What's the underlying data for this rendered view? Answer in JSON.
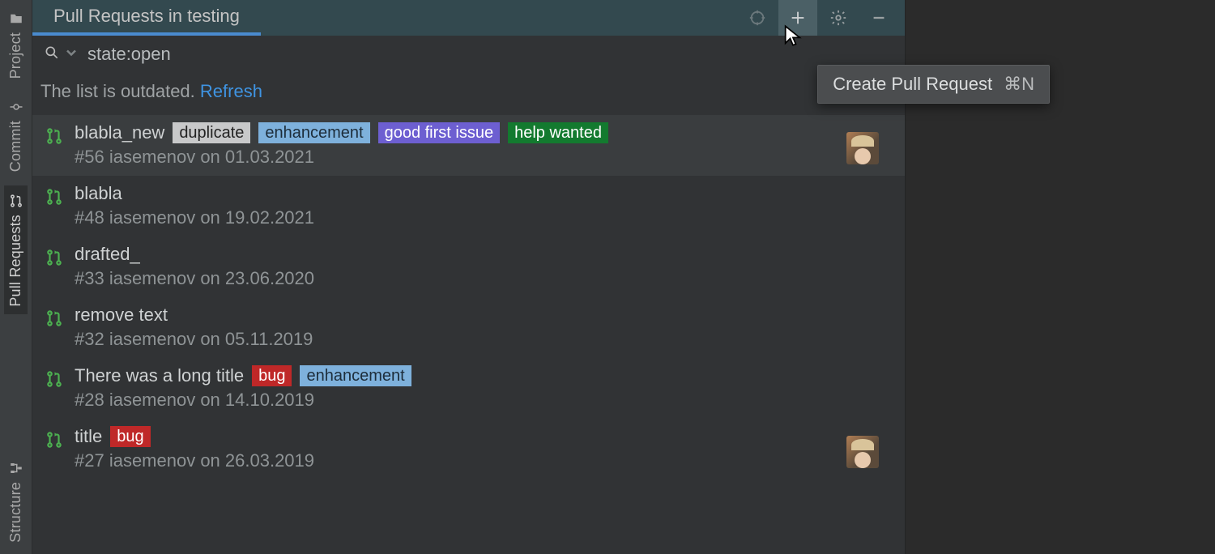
{
  "toolstrip": {
    "project": "Project",
    "commit": "Commit",
    "pull_requests": "Pull Requests",
    "structure": "Structure"
  },
  "header": {
    "tab_title": "Pull Requests in testing"
  },
  "search": {
    "value": "state:open"
  },
  "outdated": {
    "text": "The list is outdated.",
    "refresh": "Refresh"
  },
  "tooltip": {
    "text": "Create Pull Request",
    "shortcut": "⌘N"
  },
  "label_colors": {
    "duplicate": {
      "bg": "#c8c9ca",
      "fg": "#222"
    },
    "enhancement": {
      "bg": "#7eb1dc",
      "fg": "#1d2d3a"
    },
    "good_first_issue": {
      "bg": "#6d5fd1",
      "fg": "#fff"
    },
    "help_wanted": {
      "bg": "#137a2f",
      "fg": "#fff"
    },
    "bug": {
      "bg": "#bf2828",
      "fg": "#fff"
    }
  },
  "prs": [
    {
      "title": "blabla_new",
      "labels": [
        "duplicate",
        "enhancement",
        "good first issue",
        "help wanted"
      ],
      "sub": "#56 iasemenov on 01.03.2021",
      "selected": true,
      "avatar": true
    },
    {
      "title": "blabla",
      "labels": [],
      "sub": "#48 iasemenov on 19.02.2021",
      "selected": false,
      "avatar": false
    },
    {
      "title": "drafted_",
      "labels": [],
      "sub": "#33 iasemenov on 23.06.2020",
      "selected": false,
      "avatar": false
    },
    {
      "title": "remove  text",
      "labels": [],
      "sub": "#32 iasemenov on 05.11.2019",
      "selected": false,
      "avatar": false
    },
    {
      "title": "There was a long title",
      "labels": [
        "bug",
        "enhancement"
      ],
      "sub": "#28 iasemenov on 14.10.2019",
      "selected": false,
      "avatar": false
    },
    {
      "title": "title",
      "labels": [
        "bug"
      ],
      "sub": "#27 iasemenov on 26.03.2019",
      "selected": false,
      "avatar": true
    }
  ]
}
